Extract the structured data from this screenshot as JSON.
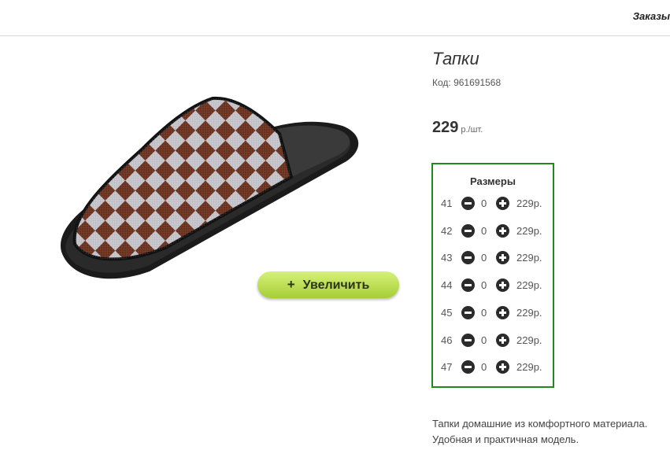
{
  "header": {
    "order_link": "Заказы"
  },
  "product": {
    "title": "Тапки",
    "code": "Код: 961691568",
    "price": "229",
    "price_unit": "р./шт.",
    "zoom_button": "Увеличить",
    "zoom_plus": "+",
    "description_line1": "Тапки домашние из комфортного материала.",
    "description_line2": "Удобная и практичная модель."
  },
  "sizes": {
    "title": "Размеры",
    "rows": [
      {
        "size": "41",
        "qty": "0",
        "price": "229р."
      },
      {
        "size": "42",
        "qty": "0",
        "price": "229р."
      },
      {
        "size": "43",
        "qty": "0",
        "price": "229р."
      },
      {
        "size": "44",
        "qty": "0",
        "price": "229р."
      },
      {
        "size": "45",
        "qty": "0",
        "price": "229р."
      },
      {
        "size": "46",
        "qty": "0",
        "price": "229р."
      },
      {
        "size": "47",
        "qty": "0",
        "price": "229р."
      }
    ]
  },
  "colors": {
    "accent_green": "#1e8a1e",
    "button_green": "#b5dc44",
    "shoe_brown": "#6b2f1a"
  }
}
